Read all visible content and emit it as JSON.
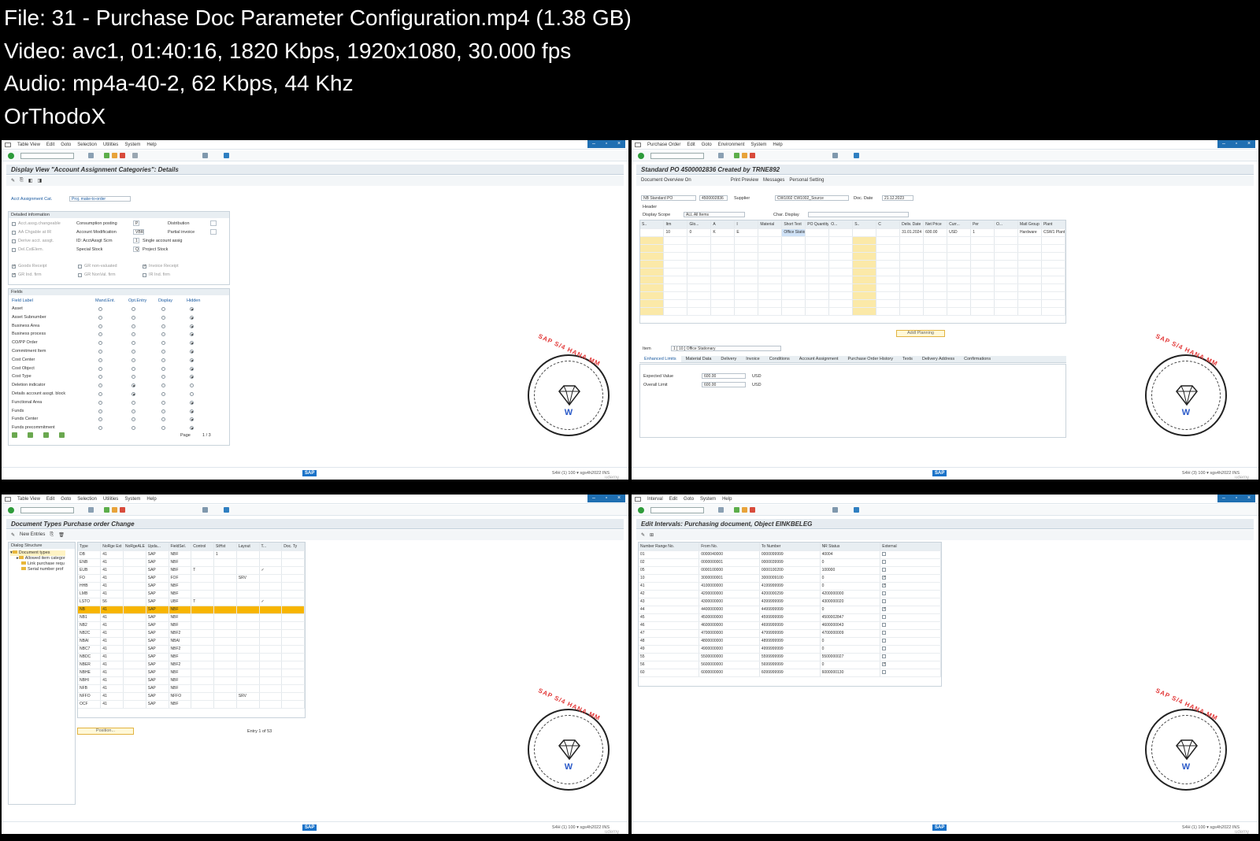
{
  "header": {
    "lines": [
      "File: 31 - Purchase Doc Parameter Configuration.mp4 (1.38 GB)",
      "Video: avc1, 01:40:16, 1820 Kbps, 1920x1080, 30.000 fps",
      "Audio: mp4a-40-2, 62 Kbps, 44 Khz",
      "OrThodoX"
    ]
  },
  "watermark": {
    "text": "SAP S/4 HANA MM",
    "mono": "W"
  },
  "status": {
    "sap": "SAP",
    "udemy": "udemy"
  },
  "p1": {
    "menu": [
      "Table View",
      "Edit",
      "Goto",
      "Selection",
      "Utilities",
      "System",
      "Help"
    ],
    "title": "Display View \"Account Assignment Categories\": Details",
    "acct_label": "Acct Assignment Cat.",
    "acct_value": "Proj. make-to-order",
    "detail_title": "Detailed information",
    "checks": [
      {
        "label": "Acct.assg.changeable",
        "on": false
      },
      {
        "label": "AA Chgable at IR",
        "on": false
      },
      {
        "label": "Derive acct. assgt.",
        "on": false
      },
      {
        "label": "Del.CstElem.",
        "on": false
      }
    ],
    "mid_labels": [
      "Consumption posting",
      "Account Modification",
      "ID: AcctAssgt Scrn",
      "Special Stock"
    ],
    "mid_values": [
      "P",
      "VBR",
      "1",
      "Q"
    ],
    "right_labels": [
      "Distribution",
      "Partial invoice",
      "Single account assig",
      "Project Stock"
    ],
    "row_checks": [
      {
        "label": "Goods Receipt",
        "on": true
      },
      {
        "label": "GR non-valuated",
        "on": false
      },
      {
        "label": "Invoice Receipt",
        "on": true
      },
      {
        "label": "GR Ind. firm",
        "on": true
      },
      {
        "label": "GR NonVal. firm",
        "on": false
      },
      {
        "label": "IR Ind. firm",
        "on": false
      }
    ],
    "fields_title": "Fields",
    "field_header": [
      "Field Label",
      "Mand.Ent.",
      "Opt.Entry",
      "Display",
      "Hidden"
    ],
    "field_rows": [
      {
        "name": "Asset",
        "sel": 3
      },
      {
        "name": "Asset Subnumber",
        "sel": 3
      },
      {
        "name": "Business Area",
        "sel": 3
      },
      {
        "name": "Business process",
        "sel": 3
      },
      {
        "name": "CO/PP Order",
        "sel": 3
      },
      {
        "name": "Commitment Item",
        "sel": 3
      },
      {
        "name": "Cost Center",
        "sel": 3
      },
      {
        "name": "Cost Object",
        "sel": 3
      },
      {
        "name": "Cost Type",
        "sel": 3
      },
      {
        "name": "Deletion indicator",
        "sel": 1
      },
      {
        "name": "Details account assgt. block",
        "sel": 1
      },
      {
        "name": "Functional Area",
        "sel": 3
      },
      {
        "name": "Funds",
        "sel": 3
      },
      {
        "name": "Funds Center",
        "sel": 3
      },
      {
        "name": "Funds precommitment",
        "sel": 3
      }
    ],
    "page_label": "Page",
    "page_value": "1 / 3",
    "status_info": "S4H (1) 100 ▾  sgs4h2022  INS"
  },
  "p2": {
    "menu": [
      "Purchase Order",
      "Edit",
      "Goto",
      "Environment",
      "System",
      "Help"
    ],
    "title": "Standard PO 4500002836 Created by TRNE892",
    "app_items": [
      "Document Overview On",
      "Print Preview",
      "Messages",
      "Personal Setting"
    ],
    "doc_type": "NB Standard PO",
    "po_number": "4500002836",
    "supplier_label": "Supplier",
    "supplier_value": "CW1002 CW1002_Source",
    "doc_date_label": "Doc. Date",
    "doc_date_value": "21.12.2023",
    "header_label": "Header",
    "display_scope_label": "Display Scope",
    "display_scope_value": "ALL All Items",
    "char_display_label": "Char. Display",
    "item_columns": [
      "S..",
      "Itm",
      "Glo...",
      "A",
      "I",
      "Material",
      "Short Text",
      "PO Quantity",
      "O...",
      "S..",
      "C",
      "Deliv. Date",
      "Net Price",
      "Curr...",
      "Per",
      "O...",
      "Matl Group",
      "Plant"
    ],
    "item_row": [
      "",
      "10",
      "0",
      "K",
      "E",
      "",
      "Office Stationary",
      "",
      "",
      "",
      "",
      "31.01.2024",
      "600.00",
      "USD",
      "1",
      "",
      "Hardware",
      "CSW1 Plant"
    ],
    "addl_planning": "Addl Planning",
    "item_label": "Item",
    "item_select": "1 [ 10 ] Office Stationary",
    "tabs": [
      "Enhanced Limits",
      "Material Data",
      "Delivery",
      "Invoice",
      "Conditions",
      "Account Assignment",
      "Purchase Order History",
      "Texts",
      "Delivery Address",
      "Confirmations"
    ],
    "expected_label": "Expected Value",
    "expected_value": "600.00",
    "overall_label": "Overall Limit",
    "overall_value": "600.00",
    "currency": "USD",
    "status_info": "S4H (3) 100 ▾  sgs4h2022  INS"
  },
  "p3": {
    "menu": [
      "Table View",
      "Edit",
      "Goto",
      "Selection",
      "Utilities",
      "System",
      "Help"
    ],
    "title": "Document Types Purchase order Change",
    "new_entries": "New Entries",
    "tree_title": "Dialog Structure",
    "tree": [
      "Document types",
      "Allowed item categor",
      "Link purchase requ",
      "Serial number prof"
    ],
    "columns": [
      "Type",
      "NoRge Ext",
      "NoRgeALE",
      "Upda...",
      "FieldSel.",
      "Control",
      "StHst",
      "Layout",
      "T...",
      "Doc. Ty"
    ],
    "rows": [
      [
        "DB",
        "41",
        "",
        "SAP",
        "NBF",
        "",
        "1",
        "",
        "",
        ""
      ],
      [
        "ENB",
        "41",
        "",
        "SAP",
        "NBF",
        "",
        "",
        "",
        "",
        ""
      ],
      [
        "EUB",
        "41",
        "",
        "SAP",
        "NBF",
        "T",
        "",
        "",
        "✓",
        ""
      ],
      [
        "FO",
        "41",
        "",
        "SAP",
        "FOF",
        "",
        "",
        "SRV",
        "",
        ""
      ],
      [
        "HHB",
        "41",
        "",
        "SAP",
        "NBF",
        "",
        "",
        "",
        "",
        ""
      ],
      [
        "LMB",
        "41",
        "",
        "SAP",
        "NBF",
        "",
        "",
        "",
        "",
        ""
      ],
      [
        "LSTO",
        "56",
        "",
        "SAP",
        "UBF",
        "T",
        "",
        "",
        "✓",
        ""
      ],
      [
        "NB",
        "41",
        "",
        "SAP",
        "NBF",
        "",
        "",
        "",
        "",
        ""
      ],
      [
        "NB1",
        "41",
        "",
        "SAP",
        "NBF",
        "",
        "",
        "",
        "",
        ""
      ],
      [
        "NB2",
        "41",
        "",
        "SAP",
        "NBF",
        "",
        "",
        "",
        "",
        ""
      ],
      [
        "NB2C",
        "41",
        "",
        "SAP",
        "NBF2",
        "",
        "",
        "",
        "",
        ""
      ],
      [
        "NBAI",
        "41",
        "",
        "SAP",
        "NBAI",
        "",
        "",
        "",
        "",
        ""
      ],
      [
        "NBC7",
        "41",
        "",
        "SAP",
        "NBF2",
        "",
        "",
        "",
        "",
        ""
      ],
      [
        "NBDC",
        "41",
        "",
        "SAP",
        "NBF",
        "",
        "",
        "",
        "",
        ""
      ],
      [
        "NBER",
        "41",
        "",
        "SAP",
        "NBF2",
        "",
        "",
        "",
        "",
        ""
      ],
      [
        "NBHE",
        "41",
        "",
        "SAP",
        "NBF",
        "",
        "",
        "",
        "",
        ""
      ],
      [
        "NBHI",
        "41",
        "",
        "SAP",
        "NBF",
        "",
        "",
        "",
        "",
        ""
      ],
      [
        "NFB",
        "41",
        "",
        "SAP",
        "NBF",
        "",
        "",
        "",
        "",
        ""
      ],
      [
        "NFFO",
        "41",
        "",
        "SAP",
        "NFFO",
        "",
        "",
        "SRV",
        "",
        ""
      ],
      [
        "OCF",
        "41",
        "",
        "SAP",
        "NBF",
        "",
        "",
        "",
        "",
        ""
      ]
    ],
    "selected_row": 7,
    "position": "Position...",
    "entry": "Entry 1 of 53",
    "status_info": "S4H (1) 100 ▾  sgs4h2022  INS"
  },
  "p4": {
    "menu": [
      "Interval",
      "Edit",
      "Goto",
      "System",
      "Help"
    ],
    "title": "Edit Intervals: Purchasing document, Object EINKBELEG",
    "columns": [
      "Number Range No.",
      "From No.",
      "To Number",
      "NR Status",
      "External"
    ],
    "rows": [
      [
        "01",
        "0000040000",
        "0000099999",
        "40004",
        false
      ],
      [
        "02",
        "0000000001",
        "0000039999",
        "0",
        false
      ],
      [
        "05",
        "0000100000",
        "0000100200",
        "100000",
        false
      ],
      [
        "10",
        "3000000001",
        "3000009100",
        "0",
        true
      ],
      [
        "41",
        "4100000000",
        "4199999999",
        "0",
        true
      ],
      [
        "42",
        "4200000000",
        "4200000299",
        "4200000000",
        false
      ],
      [
        "43",
        "4300000000",
        "4399999999",
        "4300000020",
        false
      ],
      [
        "44",
        "4400000000",
        "4499999999",
        "0",
        true
      ],
      [
        "45",
        "4500000000",
        "4599999999",
        "4500002847",
        false
      ],
      [
        "46",
        "4600000000",
        "4699999999",
        "4600000043",
        false
      ],
      [
        "47",
        "4700000000",
        "4799999999",
        "4700000009",
        false
      ],
      [
        "48",
        "4800000000",
        "4899999999",
        "0",
        false
      ],
      [
        "49",
        "4900000000",
        "4999999999",
        "0",
        false
      ],
      [
        "55",
        "5500000000",
        "5599999999",
        "5500000027",
        false
      ],
      [
        "56",
        "5600000000",
        "5699999999",
        "0",
        true
      ],
      [
        "60",
        "6000000000",
        "6099999999",
        "6000000130",
        false
      ]
    ],
    "status_info": "S4H (1) 100 ▾  sgs4h2022  INS"
  }
}
